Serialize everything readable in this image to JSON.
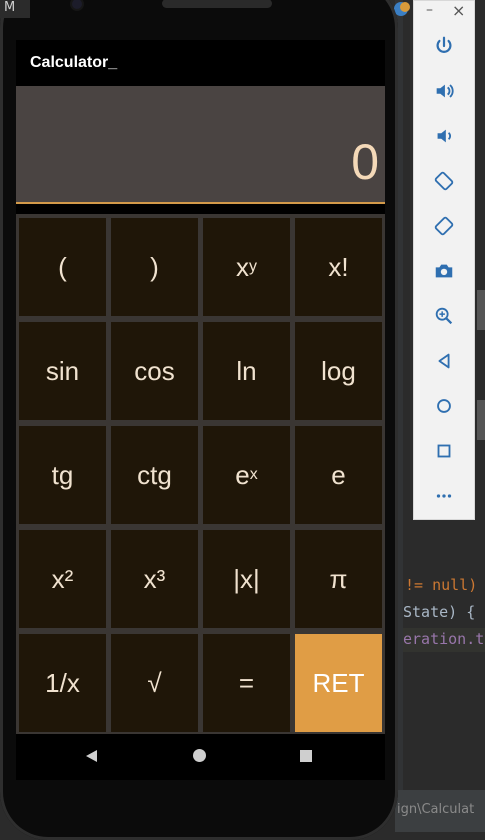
{
  "app": {
    "title": "Calculator_",
    "display_value": "0"
  },
  "keypad": {
    "rows": [
      [
        "(",
        ")",
        "x^y",
        "x!"
      ],
      [
        "sin",
        "cos",
        "ln",
        "log"
      ],
      [
        "tg",
        "ctg",
        "e^x",
        "e"
      ],
      [
        "x²",
        "x³",
        "|x|",
        "π"
      ],
      [
        "1/x",
        "√",
        "=",
        "RET"
      ]
    ]
  },
  "keys": {
    "open_paren": "(",
    "close_paren": ")",
    "pow_base": "x",
    "pow_exp": "y",
    "factorial": "x!",
    "sin": "sin",
    "cos": "cos",
    "ln": "ln",
    "log": "log",
    "tg": "tg",
    "ctg": "ctg",
    "exp_base": "e",
    "exp_exp": "x",
    "e": "e",
    "square": "x²",
    "cube": "x³",
    "abs": "|x|",
    "pi": "π",
    "reciprocal": "1/x",
    "sqrt": "√",
    "equals": "=",
    "ret": "RET"
  },
  "colors": {
    "key_bg": "#1f1608",
    "key_text": "#f0e2cf",
    "accent": "#e09d45",
    "display_bg": "#4a4442",
    "display_text": "#f4d9b8",
    "divider": "#d39a4a"
  },
  "emulator_panel": {
    "minimize": "–",
    "close": "×",
    "buttons": [
      "power-icon",
      "volume-up-icon",
      "volume-down-icon",
      "rotate-left-icon",
      "rotate-right-icon",
      "camera-icon",
      "zoom-icon",
      "back-icon",
      "home-icon",
      "overview-icon",
      "more-icon"
    ]
  },
  "window_corner": "M",
  "ide": {
    "line1": "!= null)",
    "line2": "State) {",
    "line3": "eration.t",
    "path": "ign\\Calculat"
  }
}
